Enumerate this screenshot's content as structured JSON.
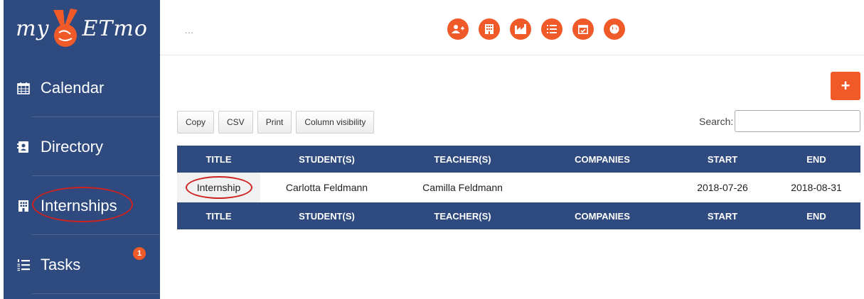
{
  "logo": {
    "prefix": "my",
    "suffix": "ETmo"
  },
  "colors": {
    "sidebar": "#2e4a7e",
    "accent": "#f05a28",
    "header": "#2e4a7e",
    "annotation": "#cc2222"
  },
  "sidebar": {
    "items": [
      {
        "label": "Calendar",
        "icon": "calendar-icon"
      },
      {
        "label": "Directory",
        "icon": "address-book-icon"
      },
      {
        "label": "Internships",
        "icon": "building-icon"
      },
      {
        "label": "Tasks",
        "icon": "list-ordered-icon",
        "badge": "1"
      }
    ]
  },
  "topbar": {
    "dots": "...",
    "icons": [
      "add-user-icon",
      "building-icon",
      "factory-icon",
      "list-icon",
      "calendar-check-icon",
      "globe-icon"
    ]
  },
  "toolbar": {
    "add_label": "+",
    "buttons": [
      "Copy",
      "CSV",
      "Print",
      "Column visibility"
    ],
    "search_label": "Search:",
    "search_value": ""
  },
  "table": {
    "columns": [
      "TITLE",
      "STUDENT(S)",
      "TEACHER(S)",
      "COMPANIES",
      "START",
      "END"
    ],
    "rows": [
      [
        "Internship",
        "Carlotta Feldmann",
        "Camilla Feldmann",
        "",
        "2018-07-26",
        "2018-08-31"
      ]
    ]
  }
}
